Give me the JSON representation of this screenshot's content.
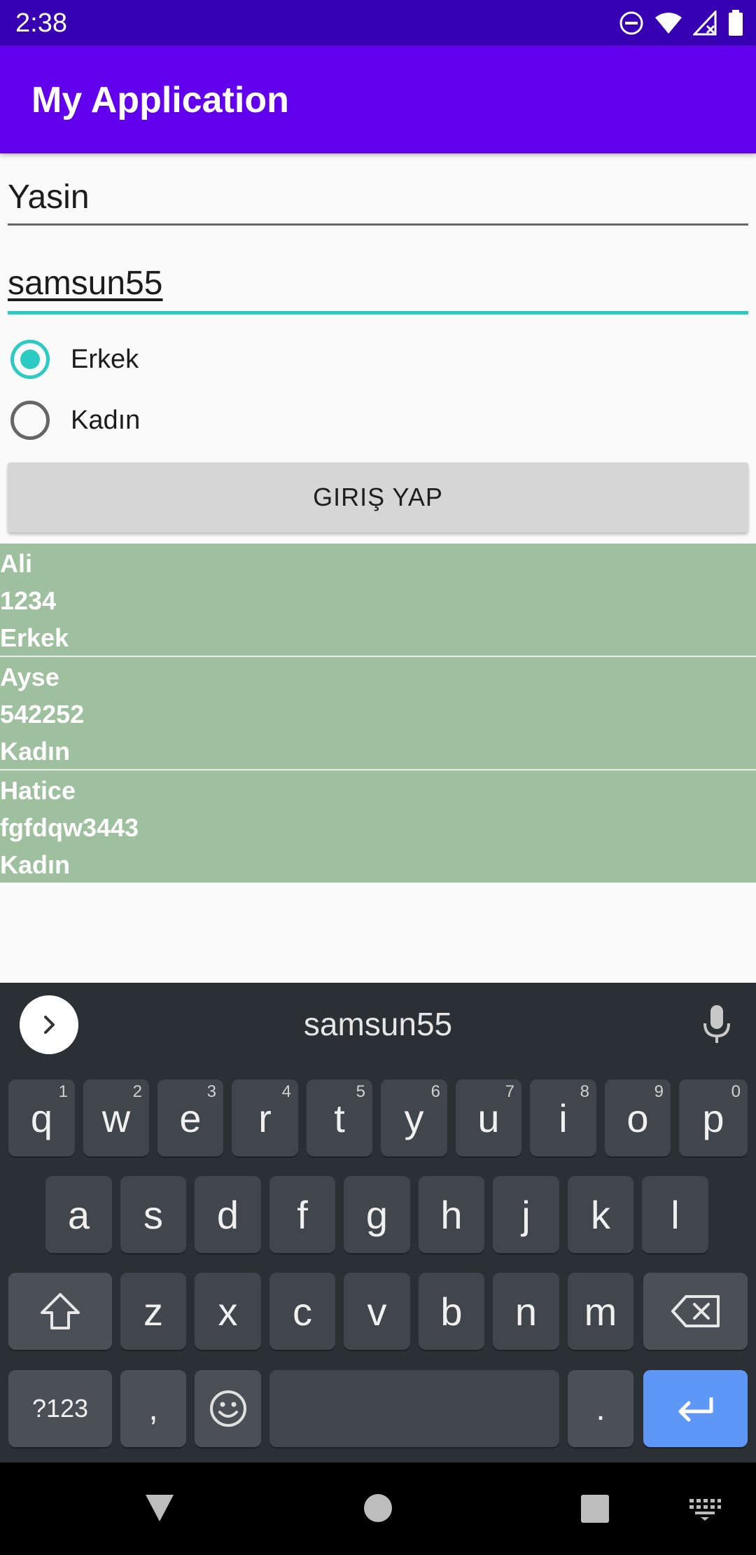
{
  "status_bar": {
    "time": "2:38"
  },
  "app_bar": {
    "title": "My Application"
  },
  "form": {
    "name_value": "Yasin",
    "password_value": "samsun55",
    "gender_options": [
      {
        "label": "Erkek",
        "selected": true
      },
      {
        "label": "Kadın",
        "selected": false
      }
    ],
    "login_button_label": "GIRIŞ YAP"
  },
  "users": [
    {
      "name": "Ali",
      "password": "1234",
      "gender": "Erkek"
    },
    {
      "name": "Ayse",
      "password": "542252",
      "gender": "Kadın"
    },
    {
      "name": "Hatice",
      "password": "fgfdqw3443",
      "gender": "Kadın"
    }
  ],
  "keyboard": {
    "suggestion": "samsun55",
    "row1": [
      {
        "key": "q",
        "hint": "1"
      },
      {
        "key": "w",
        "hint": "2"
      },
      {
        "key": "e",
        "hint": "3"
      },
      {
        "key": "r",
        "hint": "4"
      },
      {
        "key": "t",
        "hint": "5"
      },
      {
        "key": "y",
        "hint": "6"
      },
      {
        "key": "u",
        "hint": "7"
      },
      {
        "key": "i",
        "hint": "8"
      },
      {
        "key": "o",
        "hint": "9"
      },
      {
        "key": "p",
        "hint": "0"
      }
    ],
    "row2": [
      "a",
      "s",
      "d",
      "f",
      "g",
      "h",
      "j",
      "k",
      "l"
    ],
    "row3": [
      "z",
      "x",
      "c",
      "v",
      "b",
      "n",
      "m"
    ],
    "symbols_label": "?123",
    "comma_label": ",",
    "period_label": "."
  },
  "colors": {
    "status_bar": "#3700b3",
    "app_bar": "#6200ee",
    "accent": "#2bcbc3",
    "list_item_bg": "#9fc09f",
    "keyboard_bg": "#2b3034",
    "enter_key": "#5e97f6"
  }
}
